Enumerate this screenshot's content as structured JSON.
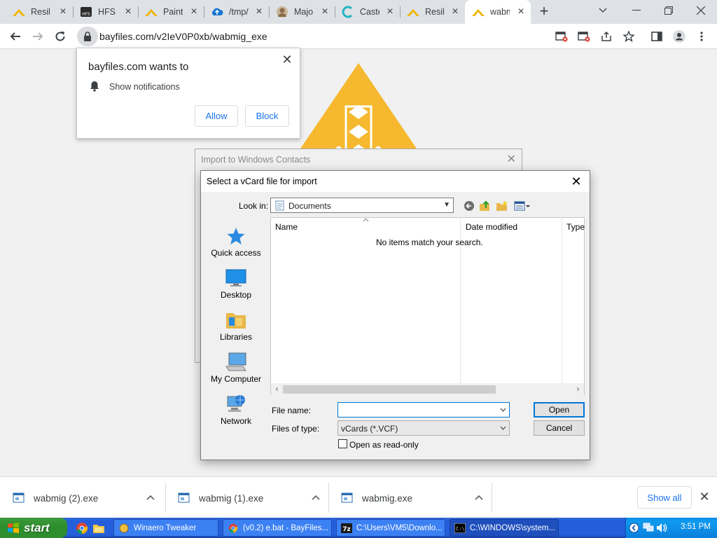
{
  "browser": {
    "tabs": [
      {
        "title": "Resilio",
        "icon": "resilio-icon"
      },
      {
        "title": "HFS -",
        "icon": "hfs-icon"
      },
      {
        "title": "Paint",
        "icon": "resilio-icon"
      },
      {
        "title": "/tmp/",
        "icon": "cloud-icon"
      },
      {
        "title": "Majo",
        "icon": "avatar-icon"
      },
      {
        "title": "Caste",
        "icon": "c-logo-icon"
      },
      {
        "title": "Resilio",
        "icon": "resilio-icon"
      },
      {
        "title": "wabmig",
        "icon": "resilio-icon",
        "active": true
      }
    ],
    "url": "bayfiles.com/v2IeV0P0xb/wabmig_exe",
    "accent_color": "#1a73e8"
  },
  "notification_prompt": {
    "title": "bayfiles.com wants to",
    "permission": "Show notifications",
    "allow_label": "Allow",
    "block_label": "Block"
  },
  "import_dialog": {
    "title": "Import to Windows Contacts"
  },
  "file_dialog": {
    "title": "Select a vCard file for import",
    "look_in_label": "Look in:",
    "look_in_value": "Documents",
    "places": [
      {
        "label": "Quick access",
        "icon": "star-icon"
      },
      {
        "label": "Desktop",
        "icon": "desktop-icon"
      },
      {
        "label": "Libraries",
        "icon": "folder-icon"
      },
      {
        "label": "My Computer",
        "icon": "computer-icon"
      },
      {
        "label": "Network",
        "icon": "network-icon"
      }
    ],
    "columns": [
      "Name",
      "Date modified",
      "Type"
    ],
    "empty_message": "No items match your search.",
    "file_name_label": "File name:",
    "file_name_value": "",
    "file_type_label": "Files of type:",
    "file_type_value": "vCards (*.VCF)",
    "readonly_label": "Open as read-only",
    "open_label": "Open",
    "cancel_label": "Cancel"
  },
  "downloads": {
    "items": [
      {
        "name": "wabmig (2).exe"
      },
      {
        "name": "wabmig (1).exe"
      },
      {
        "name": "wabmig.exe"
      }
    ],
    "show_all_label": "Show all"
  },
  "taskbar": {
    "start_label": "start",
    "tasks": [
      {
        "label": "Winaero Tweaker"
      },
      {
        "label": "(v0.2) e.bat - BayFiles..."
      },
      {
        "label": "C:\\Users\\VM5\\Downlo..."
      },
      {
        "label": "C:\\WINDOWS\\system..."
      }
    ],
    "clock": "3:51 PM"
  }
}
